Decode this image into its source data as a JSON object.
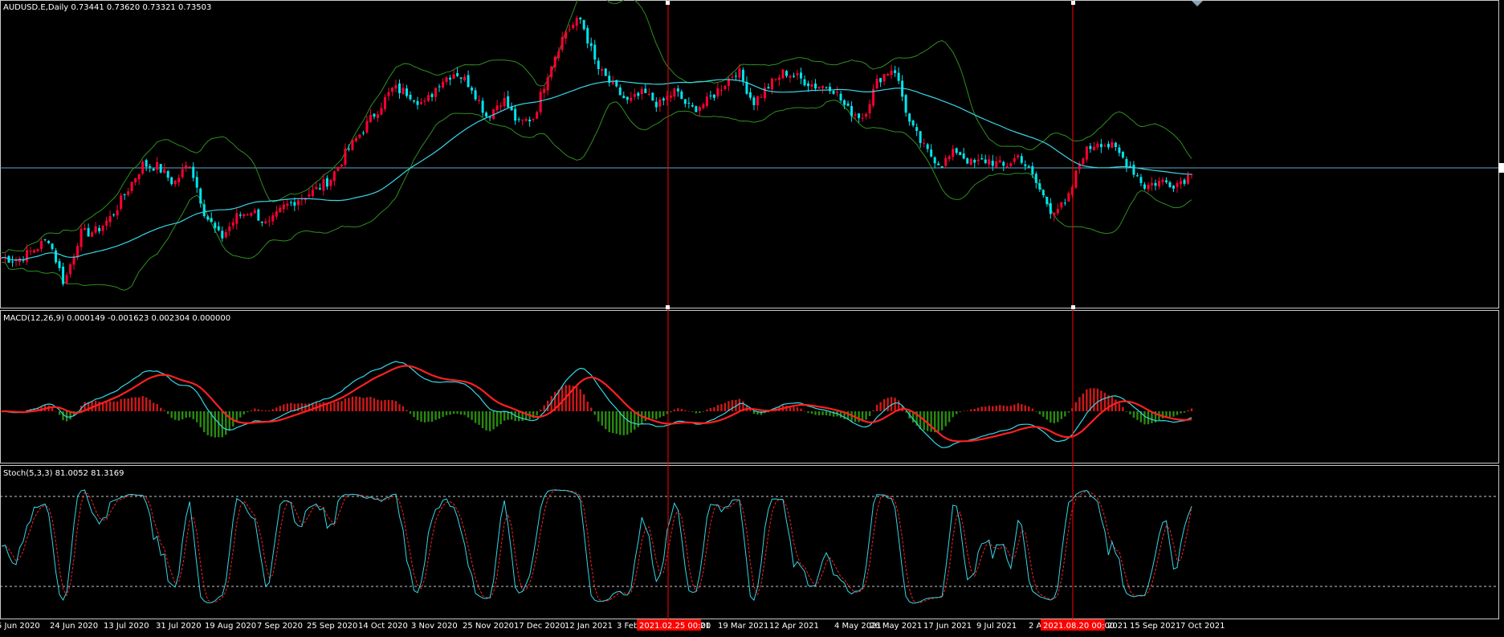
{
  "panels": {
    "price_header": "AUDUSD.E,Daily  0.73441 0.73620 0.73321 0.73503",
    "macd_header": "MACD(12,26,9) 0.000149 -0.001623 0.002304 0.000000",
    "stoch_header": "Stoch(5,3,3) 81.0052 81.3169"
  },
  "colors": {
    "background": "#000000",
    "bull_candle": "#ff0033",
    "bear_candle": "#00e5ee",
    "bollinger": "#2f8f1f",
    "moving_average": "#36d6e6",
    "macd_line": "#36d6e6",
    "signal_line": "#ff2020",
    "hist_positive": "#d01818",
    "hist_negative": "#2a8a10",
    "crosshair": "#ff0000",
    "grid_text": "#ffffff"
  },
  "crosshair_labels": [
    "2021.02.25 00:00",
    "2021.08.20 00:00"
  ],
  "chart_data": {
    "type": "candlestick",
    "symbol": "AUDUSD.E",
    "timeframe": "Daily",
    "last_bar": {
      "open": 0.73441,
      "high": 0.7362,
      "low": 0.73321,
      "close": 0.73503
    },
    "x_tick_labels": [
      "5 Jun 2020",
      "24 Jun 2020",
      "13 Jul 2020",
      "31 Jul 2020",
      "19 Aug 2020",
      "7 Sep 2020",
      "25 Sep 2020",
      "14 Oct 2020",
      "3 Nov 2020",
      "25 Nov 2020",
      "17 Dec 2020",
      "12 Jan 2021",
      "3 Feb",
      "21",
      "19 Mar 2021",
      "12 Apr 2021",
      "4 May 2021",
      "26 May 2021",
      "17 Jun 2021",
      "9 Jul 2021",
      "2 A",
      "2021",
      "15 Sep 2021",
      "7 Oct 2021"
    ],
    "close_path": [
      0.7,
      0.699,
      0.703,
      0.708,
      0.689,
      0.71,
      0.711,
      0.717,
      0.728,
      0.739,
      0.738,
      0.731,
      0.74,
      0.718,
      0.708,
      0.717,
      0.72,
      0.713,
      0.721,
      0.725,
      0.728,
      0.733,
      0.744,
      0.753,
      0.762,
      0.771,
      0.769,
      0.764,
      0.774,
      0.778,
      0.772,
      0.759,
      0.767,
      0.756,
      0.759,
      0.78,
      0.795,
      0.8,
      0.78,
      0.772,
      0.765,
      0.769,
      0.764,
      0.77,
      0.762,
      0.765,
      0.772,
      0.779,
      0.765,
      0.772,
      0.778,
      0.775,
      0.772,
      0.772,
      0.762,
      0.759,
      0.775,
      0.78,
      0.756,
      0.745,
      0.739,
      0.745,
      0.739,
      0.741,
      0.738,
      0.743,
      0.732,
      0.72,
      0.722,
      0.743,
      0.749,
      0.746,
      0.739,
      0.73,
      0.732,
      0.731,
      0.735
    ],
    "macd": {
      "macd": 0.000149,
      "signal": -0.001623,
      "histogram": 0.002304
    },
    "stochastic": {
      "k_period": 5,
      "d_period": 3,
      "slowing": 3,
      "main": 81.0052,
      "signal": 81.3169,
      "levels": [
        80,
        20
      ]
    }
  }
}
